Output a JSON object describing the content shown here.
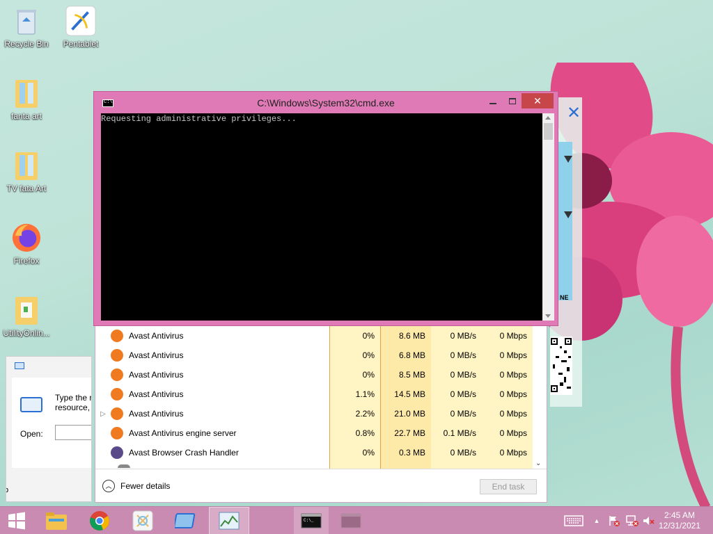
{
  "desktop": {
    "icons": [
      {
        "label": "Recycle Bin"
      },
      {
        "label": "Pentablet"
      },
      {
        "label": "fanta art"
      },
      {
        "label": "TV fata Art"
      },
      {
        "label": "Firefox"
      },
      {
        "label": "UtilityOnlin..."
      }
    ]
  },
  "cmd": {
    "title": "C:\\Windows\\System32\\cmd.exe",
    "output": "Requesting administrative privileges..."
  },
  "task_manager": {
    "processes": [
      {
        "name": "Avast Antivirus",
        "cpu": "0%",
        "memory": "8.6 MB",
        "disk": "0 MB/s",
        "network": "0 Mbps",
        "expandable": false
      },
      {
        "name": "Avast Antivirus",
        "cpu": "0%",
        "memory": "6.8 MB",
        "disk": "0 MB/s",
        "network": "0 Mbps",
        "expandable": false
      },
      {
        "name": "Avast Antivirus",
        "cpu": "0%",
        "memory": "8.5 MB",
        "disk": "0 MB/s",
        "network": "0 Mbps",
        "expandable": false
      },
      {
        "name": "Avast Antivirus",
        "cpu": "1.1%",
        "memory": "14.5 MB",
        "disk": "0 MB/s",
        "network": "0 Mbps",
        "expandable": false
      },
      {
        "name": "Avast Antivirus",
        "cpu": "2.2%",
        "memory": "21.0 MB",
        "disk": "0 MB/s",
        "network": "0 Mbps",
        "expandable": true
      },
      {
        "name": "Avast Antivirus engine server",
        "cpu": "0.8%",
        "memory": "22.7 MB",
        "disk": "0.1 MB/s",
        "network": "0 Mbps",
        "expandable": false
      },
      {
        "name": "Avast Browser Crash Handler",
        "cpu": "0%",
        "memory": "0.3 MB",
        "disk": "0 MB/s",
        "network": "0 Mbps",
        "expandable": false
      }
    ],
    "fewer_details_label": "Fewer details",
    "end_task_label": "End task"
  },
  "run_dialog": {
    "description_line1": "Type the r",
    "description_line2": "resource,",
    "open_label": "Open:",
    "open_value": ""
  },
  "side_panel": {
    "text": "NE"
  },
  "taskbar": {
    "time": "2:45 AM",
    "date": "12/31/2021"
  },
  "colors": {
    "taskbar": "#c98bb1",
    "cmd_frame": "#e07ab6",
    "close_button": "#c7464a",
    "cpu_column_bg": "#fff4c4",
    "memory_column_bg": "#fde9a8"
  }
}
